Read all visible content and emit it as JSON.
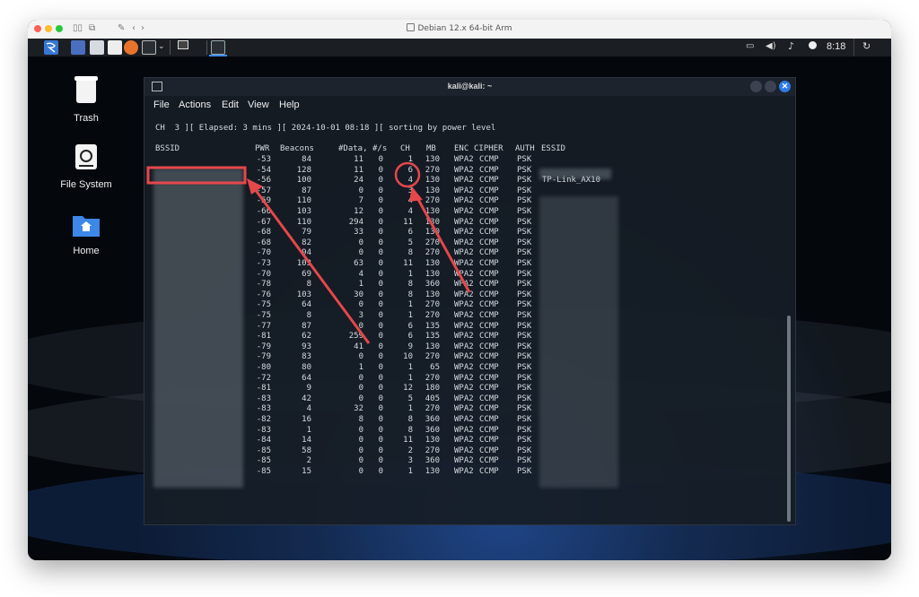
{
  "host_window": {
    "title": "Debian 12.x 64-bit Arm"
  },
  "panel": {
    "clock": "8:18"
  },
  "desktop_icons": [
    {
      "label": "Trash",
      "icon": "trash-icon"
    },
    {
      "label": "File System",
      "icon": "drive-icon"
    },
    {
      "label": "Home",
      "icon": "home-folder-icon"
    }
  ],
  "terminal": {
    "title": "kali@kali: ~",
    "menu": [
      "File",
      "Actions",
      "Edit",
      "View",
      "Help"
    ],
    "status_line": "CH  3 ][ Elapsed: 3 mins ][ 2024-10-01 08:18 ][ sorting by power level",
    "headers": {
      "bssid": "BSSID",
      "pwr": "PWR",
      "beacons": "Beacons",
      "data": "#Data,",
      "rate": "#/s",
      "ch": "CH",
      "mb": "MB",
      "enc": "ENC",
      "cipher": "CIPHER",
      "auth": "AUTH",
      "essid": "ESSID"
    },
    "rows": [
      {
        "pwr": "-53",
        "beacons": "84",
        "data": "11",
        "rate": "0",
        "ch": "1",
        "mb": "130",
        "enc": "WPA2",
        "cipher": "CCMP",
        "auth": "PSK",
        "essid": ""
      },
      {
        "pwr": "-54",
        "beacons": "128",
        "data": "11",
        "rate": "0",
        "ch": "6",
        "mb": "270",
        "enc": "WPA2",
        "cipher": "CCMP",
        "auth": "PSK",
        "essid": ""
      },
      {
        "pwr": "-56",
        "beacons": "100",
        "data": "24",
        "rate": "0",
        "ch": "4",
        "mb": "130",
        "enc": "WPA2",
        "cipher": "CCMP",
        "auth": "PSK",
        "essid": "TP-Link_AX10"
      },
      {
        "pwr": "-57",
        "beacons": "87",
        "data": "0",
        "rate": "0",
        "ch": "3",
        "mb": "130",
        "enc": "WPA2",
        "cipher": "CCMP",
        "auth": "PSK",
        "essid": ""
      },
      {
        "pwr": "-59",
        "beacons": "110",
        "data": "7",
        "rate": "0",
        "ch": "4",
        "mb": "270",
        "enc": "WPA2",
        "cipher": "CCMP",
        "auth": "PSK",
        "essid": ""
      },
      {
        "pwr": "-66",
        "beacons": "103",
        "data": "12",
        "rate": "0",
        "ch": "4",
        "mb": "130",
        "enc": "WPA2",
        "cipher": "CCMP",
        "auth": "PSK",
        "essid": ""
      },
      {
        "pwr": "-67",
        "beacons": "110",
        "data": "294",
        "rate": "0",
        "ch": "11",
        "mb": "130",
        "enc": "WPA2",
        "cipher": "CCMP",
        "auth": "PSK",
        "essid": ""
      },
      {
        "pwr": "-68",
        "beacons": "79",
        "data": "33",
        "rate": "0",
        "ch": "6",
        "mb": "130",
        "enc": "WPA2",
        "cipher": "CCMP",
        "auth": "PSK",
        "essid": ""
      },
      {
        "pwr": "-68",
        "beacons": "82",
        "data": "0",
        "rate": "0",
        "ch": "5",
        "mb": "270",
        "enc": "WPA2",
        "cipher": "CCMP",
        "auth": "PSK",
        "essid": ""
      },
      {
        "pwr": "-70",
        "beacons": "94",
        "data": "0",
        "rate": "0",
        "ch": "8",
        "mb": "270",
        "enc": "WPA2",
        "cipher": "CCMP",
        "auth": "PSK",
        "essid": ""
      },
      {
        "pwr": "-73",
        "beacons": "103",
        "data": "63",
        "rate": "0",
        "ch": "11",
        "mb": "130",
        "enc": "WPA2",
        "cipher": "CCMP",
        "auth": "PSK",
        "essid": ""
      },
      {
        "pwr": "-70",
        "beacons": "69",
        "data": "4",
        "rate": "0",
        "ch": "1",
        "mb": "130",
        "enc": "WPA2",
        "cipher": "CCMP",
        "auth": "PSK",
        "essid": ""
      },
      {
        "pwr": "-78",
        "beacons": "8",
        "data": "1",
        "rate": "0",
        "ch": "8",
        "mb": "360",
        "enc": "WPA2",
        "cipher": "CCMP",
        "auth": "PSK",
        "essid": ""
      },
      {
        "pwr": "-76",
        "beacons": "103",
        "data": "30",
        "rate": "0",
        "ch": "8",
        "mb": "130",
        "enc": "WPA2",
        "cipher": "CCMP",
        "auth": "PSK",
        "essid": ""
      },
      {
        "pwr": "-75",
        "beacons": "64",
        "data": "0",
        "rate": "0",
        "ch": "1",
        "mb": "270",
        "enc": "WPA2",
        "cipher": "CCMP",
        "auth": "PSK",
        "essid": ""
      },
      {
        "pwr": "-75",
        "beacons": "8",
        "data": "3",
        "rate": "0",
        "ch": "1",
        "mb": "270",
        "enc": "WPA2",
        "cipher": "CCMP",
        "auth": "PSK",
        "essid": ""
      },
      {
        "pwr": "-77",
        "beacons": "87",
        "data": "0",
        "rate": "0",
        "ch": "6",
        "mb": "135",
        "enc": "WPA2",
        "cipher": "CCMP",
        "auth": "PSK",
        "essid": ""
      },
      {
        "pwr": "-81",
        "beacons": "62",
        "data": "259",
        "rate": "0",
        "ch": "6",
        "mb": "135",
        "enc": "WPA2",
        "cipher": "CCMP",
        "auth": "PSK",
        "essid": ""
      },
      {
        "pwr": "-79",
        "beacons": "93",
        "data": "41",
        "rate": "0",
        "ch": "9",
        "mb": "130",
        "enc": "WPA2",
        "cipher": "CCMP",
        "auth": "PSK",
        "essid": ""
      },
      {
        "pwr": "-79",
        "beacons": "83",
        "data": "0",
        "rate": "0",
        "ch": "10",
        "mb": "270",
        "enc": "WPA2",
        "cipher": "CCMP",
        "auth": "PSK",
        "essid": ""
      },
      {
        "pwr": "-80",
        "beacons": "80",
        "data": "1",
        "rate": "0",
        "ch": "1",
        "mb": "65",
        "enc": "WPA2",
        "cipher": "CCMP",
        "auth": "PSK",
        "essid": ""
      },
      {
        "pwr": "-72",
        "beacons": "64",
        "data": "0",
        "rate": "0",
        "ch": "1",
        "mb": "270",
        "enc": "WPA2",
        "cipher": "CCMP",
        "auth": "PSK",
        "essid": ""
      },
      {
        "pwr": "-81",
        "beacons": "9",
        "data": "0",
        "rate": "0",
        "ch": "12",
        "mb": "180",
        "enc": "WPA2",
        "cipher": "CCMP",
        "auth": "PSK",
        "essid": ""
      },
      {
        "pwr": "-83",
        "beacons": "42",
        "data": "0",
        "rate": "0",
        "ch": "5",
        "mb": "405",
        "enc": "WPA2",
        "cipher": "CCMP",
        "auth": "PSK",
        "essid": ""
      },
      {
        "pwr": "-83",
        "beacons": "4",
        "data": "32",
        "rate": "0",
        "ch": "1",
        "mb": "270",
        "enc": "WPA2",
        "cipher": "CCMP",
        "auth": "PSK",
        "essid": ""
      },
      {
        "pwr": "-82",
        "beacons": "16",
        "data": "8",
        "rate": "0",
        "ch": "8",
        "mb": "360",
        "enc": "WPA2",
        "cipher": "CCMP",
        "auth": "PSK",
        "essid": ""
      },
      {
        "pwr": "-83",
        "beacons": "1",
        "data": "0",
        "rate": "0",
        "ch": "8",
        "mb": "360",
        "enc": "WPA2",
        "cipher": "CCMP",
        "auth": "PSK",
        "essid": ""
      },
      {
        "pwr": "-84",
        "beacons": "14",
        "data": "0",
        "rate": "0",
        "ch": "11",
        "mb": "130",
        "enc": "WPA2",
        "cipher": "CCMP",
        "auth": "PSK",
        "essid": ""
      },
      {
        "pwr": "-85",
        "beacons": "58",
        "data": "0",
        "rate": "0",
        "ch": "2",
        "mb": "270",
        "enc": "WPA2",
        "cipher": "CCMP",
        "auth": "PSK",
        "essid": ""
      },
      {
        "pwr": "-85",
        "beacons": "2",
        "data": "0",
        "rate": "0",
        "ch": "3",
        "mb": "360",
        "enc": "WPA2",
        "cipher": "CCMP",
        "auth": "PSK",
        "essid": ""
      },
      {
        "pwr": "-85",
        "beacons": "15",
        "data": "0",
        "rate": "0",
        "ch": "1",
        "mb": "130",
        "enc": "WPA2",
        "cipher": "CCMP",
        "auth": "PSK",
        "essid": ""
      }
    ]
  },
  "annotations": {
    "color": "#e5474b"
  }
}
